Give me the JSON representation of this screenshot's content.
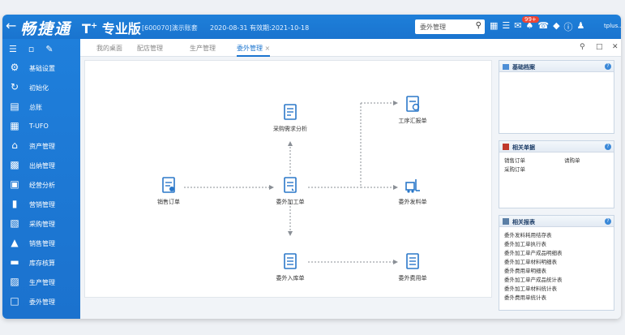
{
  "app": {
    "logo": "畅捷通",
    "edition": "T",
    "edition_sup": "+",
    "edition_suffix": "专业版",
    "company": "[600070]演示账套",
    "date_info": "2020-08-31  有效期:2021-10-18",
    "search_value": "委外管理",
    "notify_count": "99+",
    "user": "tplus..."
  },
  "colors": {
    "brand_blue": "#1a74cf",
    "sidebar_blue": "#1f7fdb",
    "panel_border": "#c9d6e4"
  },
  "sidebar": {
    "items": [
      {
        "label": "基础设置",
        "icon": "gear-icon"
      },
      {
        "label": "初始化",
        "icon": "reset-icon"
      },
      {
        "label": "总账",
        "icon": "ledger-icon"
      },
      {
        "label": "T-UFO",
        "icon": "report-icon"
      },
      {
        "label": "资产管理",
        "icon": "bank-icon"
      },
      {
        "label": "出纳管理",
        "icon": "cashier-icon"
      },
      {
        "label": "经营分析",
        "icon": "analysis-icon"
      },
      {
        "label": "营销管理",
        "icon": "bar-chart-icon"
      },
      {
        "label": "采购管理",
        "icon": "purchase-icon"
      },
      {
        "label": "销售管理",
        "icon": "sales-icon"
      },
      {
        "label": "库存核算",
        "icon": "inventory-icon"
      },
      {
        "label": "生产管理",
        "icon": "production-icon"
      },
      {
        "label": "委外管理",
        "icon": "outsource-icon"
      }
    ]
  },
  "tabs": [
    {
      "label": "我的桌面"
    },
    {
      "label": "配店管理"
    },
    {
      "label": "生产管理"
    },
    {
      "label": "委外管理",
      "close": "×"
    }
  ],
  "flow": {
    "nodes": {
      "sales_order": "销售订单",
      "purchase_analysis": "采购需求分析",
      "outsource_order": "委外加工单",
      "outsource_inbound": "委外入库单",
      "process_report": "工序汇报单",
      "outsource_material": "委外发料单",
      "outsource_fee": "委外费用单"
    }
  },
  "panels": {
    "basic": {
      "title": "基础档案",
      "help": "?"
    },
    "related_docs": {
      "title": "相关单据",
      "help": "?",
      "links": [
        "销售订单",
        "请购单",
        "采购订单"
      ]
    },
    "related_reports": {
      "title": "相关报表",
      "help": "?",
      "links": [
        "委外发料耗用结存表",
        "委外加工单执行表",
        "委外加工单产成品明细表",
        "委外加工单材料明细表",
        "委外费用单明细表",
        "委外加工单产成品统计表",
        "委外加工单材料统计表",
        "委外费用单统计表"
      ]
    }
  }
}
